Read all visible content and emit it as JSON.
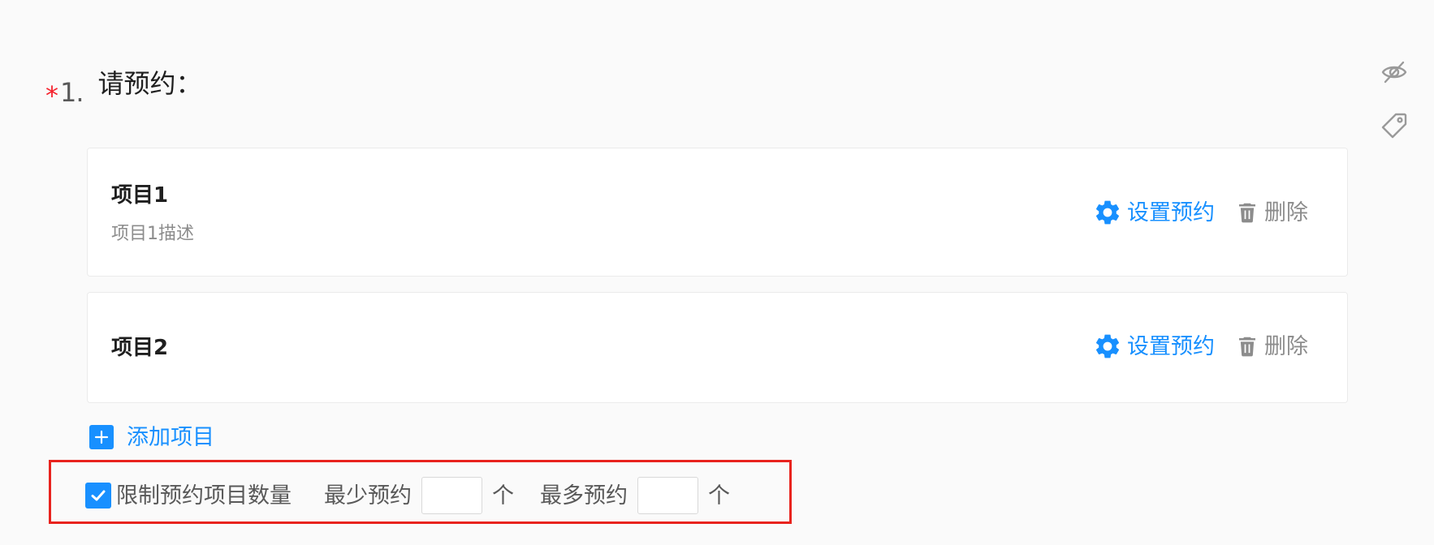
{
  "question": {
    "required_mark": "*",
    "number": "1.",
    "title": "请预约："
  },
  "side_icons": [
    "eye-slash-icon",
    "tag-icon"
  ],
  "items": [
    {
      "title": "项目1",
      "description": "项目1描述",
      "setting_label": "设置预约",
      "delete_label": "删除"
    },
    {
      "title": "项目2",
      "setting_label": "设置预约",
      "delete_label": "删除"
    }
  ],
  "add_item": {
    "label": "添加项目"
  },
  "limit": {
    "checked": true,
    "label": "限制预约项目数量",
    "min_label": "最少预约",
    "min_value": "",
    "min_unit": "个",
    "max_label": "最多预约",
    "max_value": "",
    "max_unit": "个"
  },
  "colors": {
    "accent": "#1890ff",
    "required": "#f5222d",
    "highlight_frame": "#e8231e",
    "muted": "#8c8c8c"
  }
}
